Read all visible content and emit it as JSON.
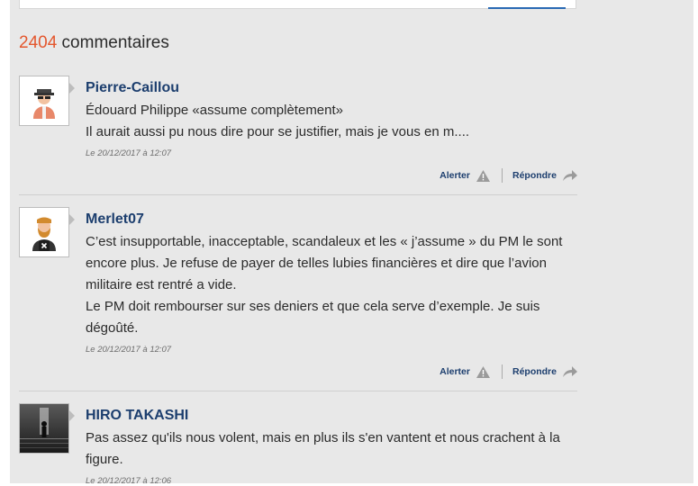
{
  "header": {
    "count": "2404",
    "label": " commentaires"
  },
  "comments": [
    {
      "author": "Pierre-Caillou",
      "lines": [
        "Édouard Philippe «assume complètement»",
        "Il aurait aussi pu nous dire pour se justifier, mais je vous en m...."
      ],
      "date": "Le 20/12/2017 à 12:07",
      "alert_label": "Alerter",
      "reply_label": "Répondre"
    },
    {
      "author": "Merlet07",
      "lines": [
        "C’est insupportable, inacceptable, scandaleux et les « j’assume » du PM le sont encore plus. Je refuse de payer de telles lubies financières et dire que l’avion militaire est rentré a vide.",
        "Le PM doit rembourser sur ses deniers et que cela serve d’exemple. Je suis dégoûté."
      ],
      "date": "Le 20/12/2017 à 12:07",
      "alert_label": "Alerter",
      "reply_label": "Répondre"
    },
    {
      "author": "HIRO TAKASHI",
      "lines": [
        "Pas assez qu'ils nous volent, mais en plus ils s'en vantent et nous crachent à la figure."
      ],
      "date": "Le 20/12/2017 à 12:06"
    }
  ]
}
